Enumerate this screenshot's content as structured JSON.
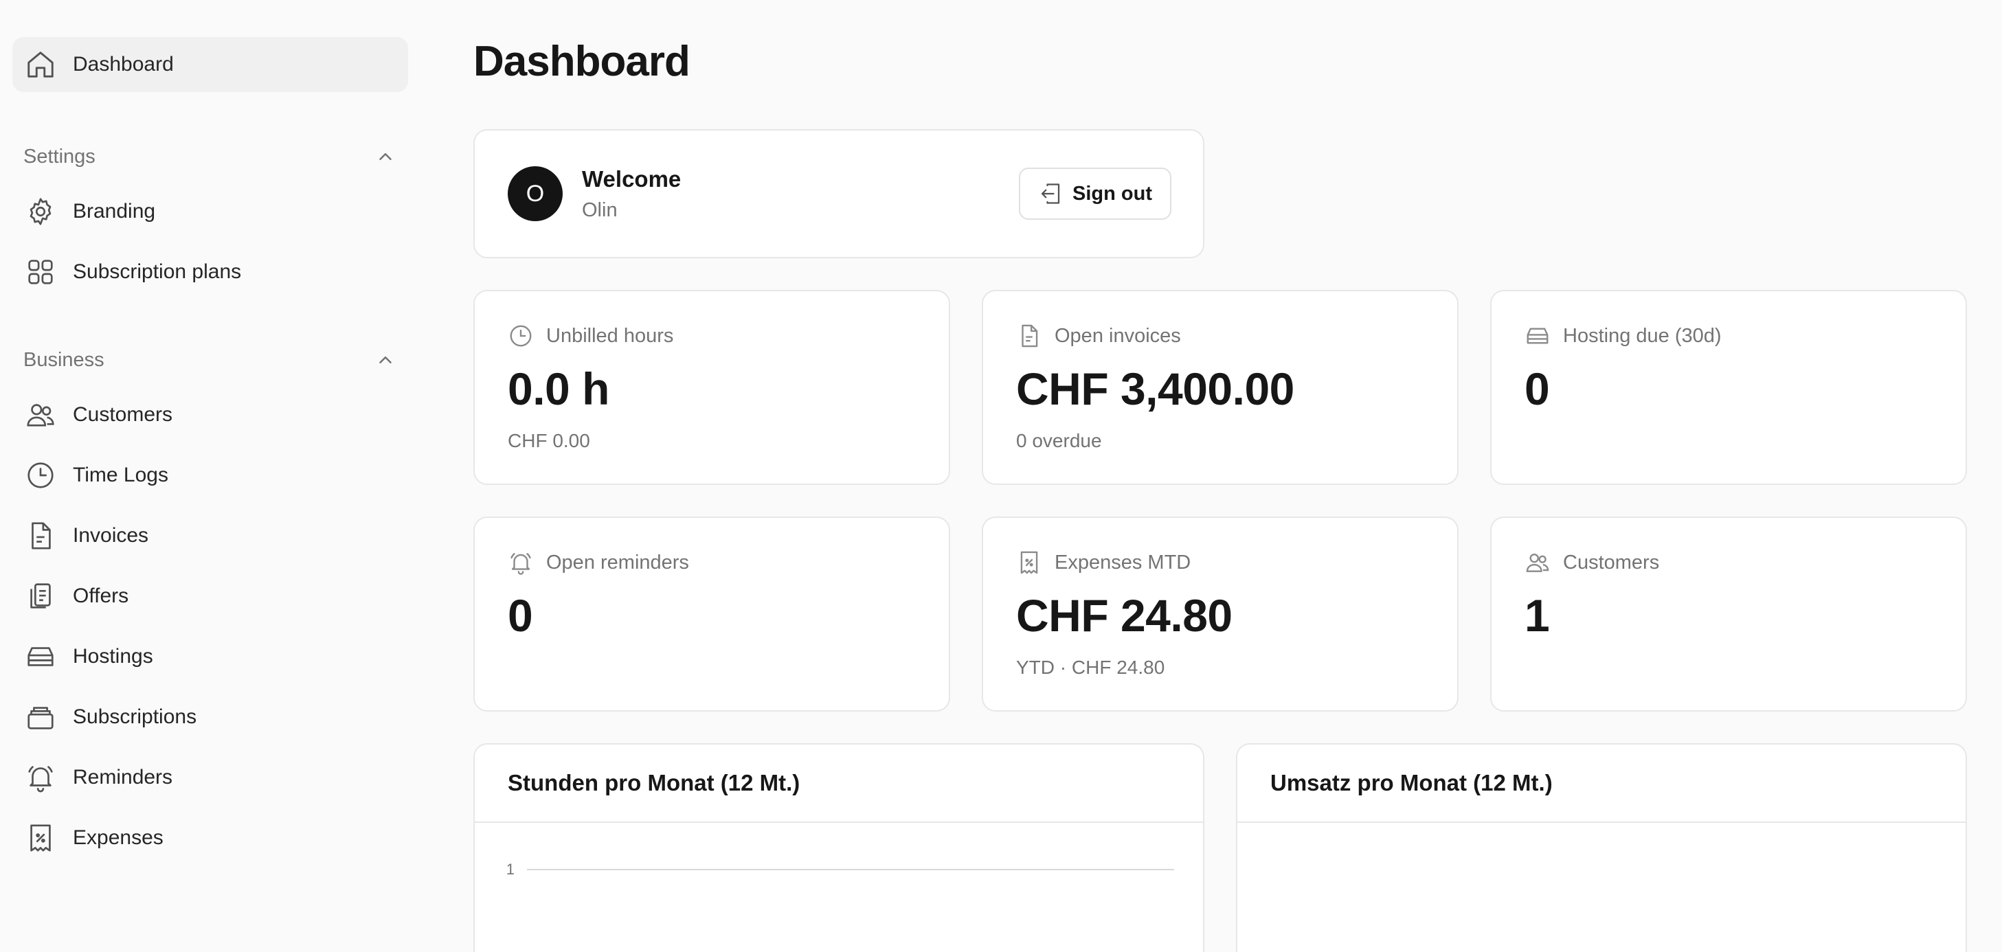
{
  "sidebar": {
    "top": {
      "label": "Dashboard",
      "icon": "home-icon"
    },
    "groups": [
      {
        "title": "Settings",
        "items": [
          {
            "label": "Branding",
            "icon": "gear-icon"
          },
          {
            "label": "Subscription plans",
            "icon": "grid-icon"
          }
        ]
      },
      {
        "title": "Business",
        "items": [
          {
            "label": "Customers",
            "icon": "users-icon"
          },
          {
            "label": "Time Logs",
            "icon": "clock-icon"
          },
          {
            "label": "Invoices",
            "icon": "document-icon"
          },
          {
            "label": "Offers",
            "icon": "clipboard-icon"
          },
          {
            "label": "Hostings",
            "icon": "server-icon"
          },
          {
            "label": "Subscriptions",
            "icon": "stack-icon"
          },
          {
            "label": "Reminders",
            "icon": "bell-icon"
          },
          {
            "label": "Expenses",
            "icon": "receipt-icon"
          }
        ]
      }
    ]
  },
  "page": {
    "title": "Dashboard"
  },
  "welcome": {
    "avatar_initial": "O",
    "title": "Welcome",
    "name": "Olin",
    "sign_out_label": "Sign out"
  },
  "stats": [
    {
      "label": "Unbilled hours",
      "value": "0.0 h",
      "sub": "CHF 0.00",
      "icon": "clock-icon"
    },
    {
      "label": "Open invoices",
      "value": "CHF 3,400.00",
      "sub": "0 overdue",
      "icon": "document-icon"
    },
    {
      "label": "Hosting due (30d)",
      "value": "0",
      "sub": "",
      "icon": "server-icon"
    },
    {
      "label": "Open reminders",
      "value": "0",
      "sub": "",
      "icon": "bell-icon"
    },
    {
      "label": "Expenses MTD",
      "value": "CHF 24.80",
      "sub": "YTD · CHF 24.80",
      "icon": "receipt-icon"
    },
    {
      "label": "Customers",
      "value": "1",
      "sub": "",
      "icon": "users-icon"
    }
  ],
  "charts": [
    {
      "title": "Stunden pro Monat (12 Mt.)",
      "y_tick": "1"
    },
    {
      "title": "Umsatz pro Monat (12 Mt.)"
    }
  ],
  "chart_data": [
    {
      "type": "line",
      "title": "Stunden pro Monat (12 Mt.)",
      "y_ticks": [
        "1"
      ],
      "series": []
    },
    {
      "type": "line",
      "title": "Umsatz pro Monat (12 Mt.)",
      "series": []
    }
  ]
}
